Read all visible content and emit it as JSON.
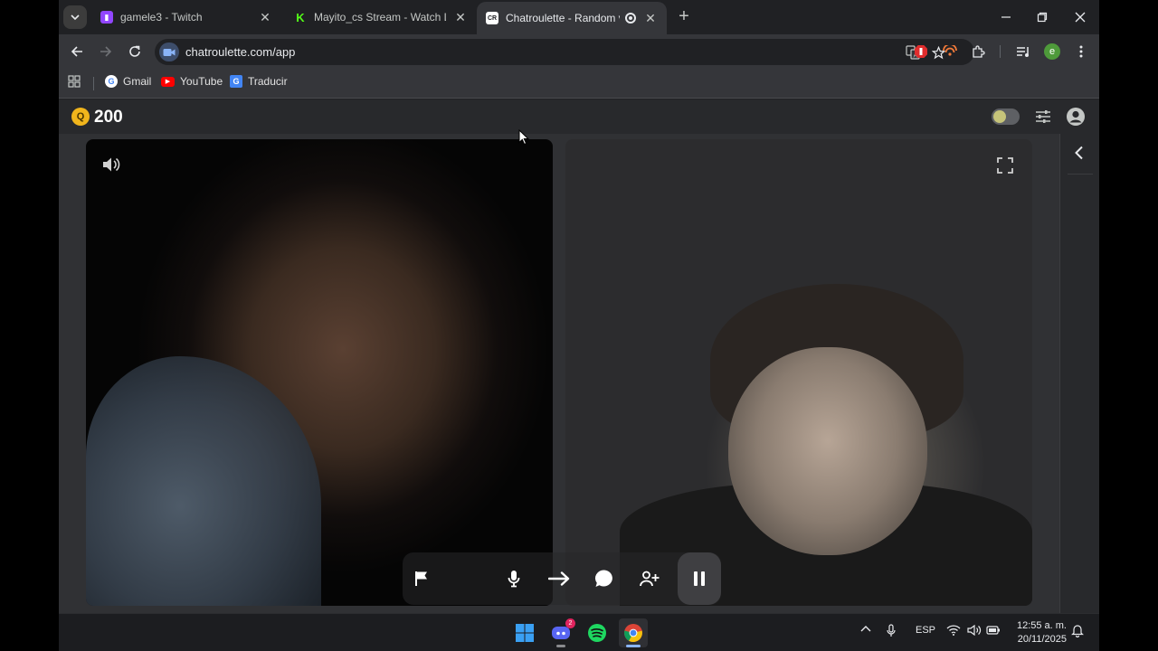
{
  "browser": {
    "tabs": [
      {
        "title": "gamele3 - Twitch",
        "favicon": "twitch-icon",
        "color": "#9146ff",
        "active": false
      },
      {
        "title": "Mayito_cs Stream - Watch Live",
        "favicon": "kick-icon",
        "color": "#53fc18",
        "active": false
      },
      {
        "title": "Chatroulette - Random vide",
        "favicon": "chatroulette-icon",
        "color": "#ffffff",
        "active": true
      }
    ],
    "url": "chatroulette.com/app",
    "bookmarks": [
      {
        "label": "Gmail",
        "icon": "google-icon"
      },
      {
        "label": "YouTube",
        "icon": "youtube-icon"
      },
      {
        "label": "Traducir",
        "icon": "translate-icon"
      }
    ],
    "profile_initial": "e"
  },
  "page": {
    "coins": "200",
    "coin_symbol": "Q"
  },
  "taskbar": {
    "discord_badge": "2",
    "language": "ESP",
    "time": "12:55 a. m.",
    "date": "20/11/2025"
  },
  "colors": {
    "accent_coin": "#f1b51c",
    "page_bg": "#303134",
    "toolbar_bg": "#35363a"
  }
}
